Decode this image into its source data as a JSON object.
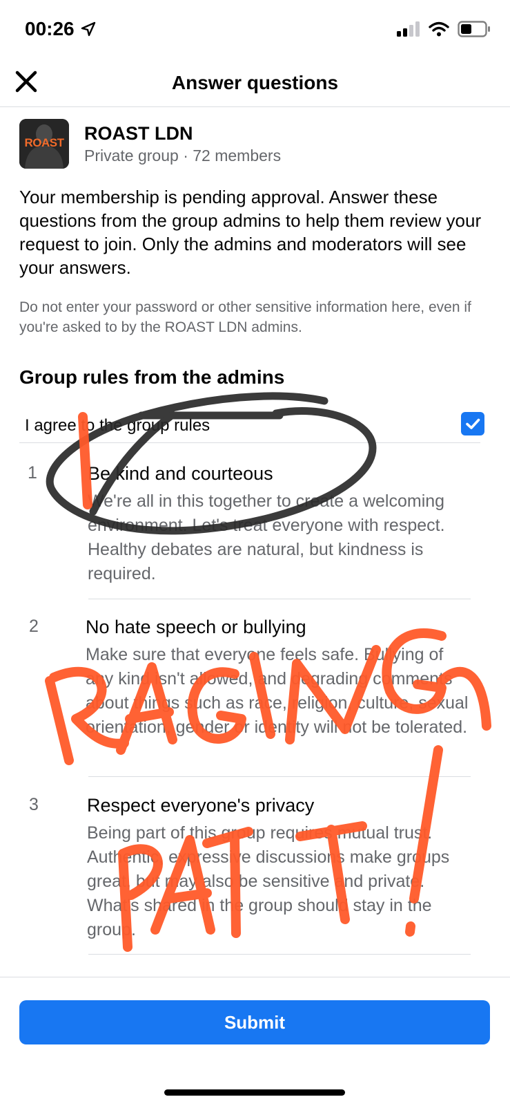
{
  "status_bar": {
    "time": "00:26"
  },
  "header": {
    "title": "Answer questions"
  },
  "group": {
    "name": "ROAST LDN",
    "meta": "Private group · 72 members",
    "avatar_text": "ROAST"
  },
  "intro_text": "Your membership is pending approval. Answer these questions from the group admins to help them review your request to join. Only the admins and moderators will see your answers.",
  "warning_text": "Do not enter your password or other sensitive information here, even if you're asked to by the ROAST LDN admins.",
  "rules_section": {
    "heading": "Group rules from the admins",
    "agree_label": "I agree to the group rules",
    "agree_checked": true,
    "rules": [
      {
        "number": "1",
        "title": "Be kind and courteous",
        "description": "We're all in this together to create a welcoming environment. Let's treat everyone with respect. Healthy debates are natural, but kindness is required."
      },
      {
        "number": "2",
        "title": "No hate speech or bullying",
        "description": "Make sure that everyone feels safe. Bullying of any kind isn't allowed, and degrading comments about things such as race, religion, culture, sexual orientation, gender or identity will not be tolerated."
      },
      {
        "number": "3",
        "title": "Respect everyone's privacy",
        "description": "Being part of this group requires mutual trust. Authentic, expressive discussions make groups great, but may also be sensitive and private. What's shared in the group should stay in the group."
      }
    ]
  },
  "submit_label": "Submit",
  "annotations": {
    "text": "RAGING PATT!",
    "color": "#ff5a2a",
    "circle_color": "#2a2a2a"
  },
  "colors": {
    "accent": "#1877f2",
    "secondary_text": "#65676b"
  }
}
